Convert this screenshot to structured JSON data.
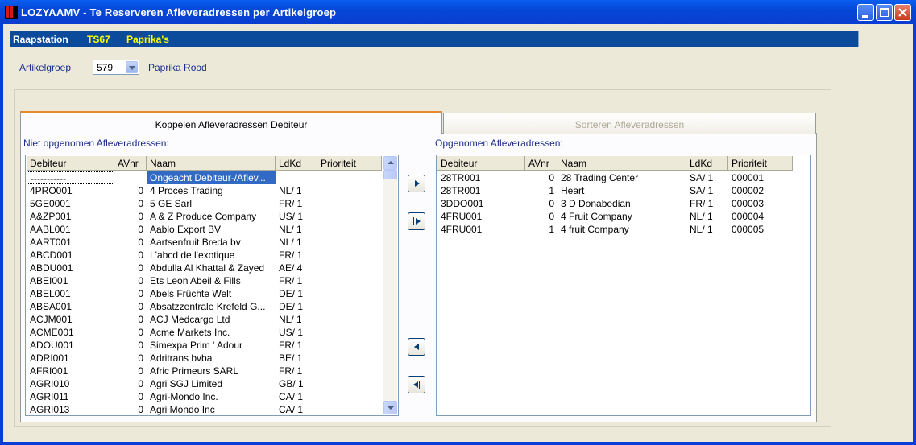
{
  "window": {
    "title": "LOZYAAMV - Te Reserveren Afleveradressen per Artikelgroep"
  },
  "info_bar": {
    "label": "Raapstation",
    "station": "TS67",
    "description": "Paprika's"
  },
  "artikelgroep": {
    "label": "Artikelgroep",
    "value": "579",
    "name": "Paprika Rood"
  },
  "tabs": [
    {
      "label": "Koppelen Afleveradressen Debiteur",
      "active": true
    },
    {
      "label": "Sorteren Afleveradressen",
      "active": false
    }
  ],
  "left_list": {
    "label": "Niet opgenomen Afleveradressen:",
    "columns": [
      "Debiteur",
      "AVnr",
      "Naam",
      "LdKd",
      "Prioriteit"
    ],
    "rows": [
      [
        "-----------",
        "",
        "Ongeacht Debiteur-/Aflev...",
        "",
        ""
      ],
      [
        "4PRO001",
        "0",
        "4 Proces Trading",
        "NL/ 1",
        ""
      ],
      [
        "5GE0001",
        "0",
        "5 GE Sarl",
        "FR/ 1",
        ""
      ],
      [
        "A&ZP001",
        "0",
        "A & Z Produce Company",
        "US/ 1",
        ""
      ],
      [
        "AABL001",
        "0",
        "Aablo Export BV",
        "NL/ 1",
        ""
      ],
      [
        "AART001",
        "0",
        "Aartsenfruit Breda bv",
        "NL/ 1",
        ""
      ],
      [
        "ABCD001",
        "0",
        "L'abcd de l'exotique",
        "FR/ 1",
        ""
      ],
      [
        "ABDU001",
        "0",
        "Abdulla Al Khattal & Zayed",
        "AE/ 4",
        ""
      ],
      [
        "ABEI001",
        "0",
        "Ets Leon Abeil & Fills",
        "FR/ 1",
        ""
      ],
      [
        "ABEL001",
        "0",
        "Abels Früchte Welt",
        "DE/ 1",
        ""
      ],
      [
        "ABSA001",
        "0",
        "Absatzzentrale Krefeld G...",
        "DE/ 1",
        ""
      ],
      [
        "ACJM001",
        "0",
        "ACJ Medcargo Ltd",
        "NL/ 1",
        ""
      ],
      [
        "ACME001",
        "0",
        "Acme Markets Inc.",
        "US/ 1",
        ""
      ],
      [
        "ADOU001",
        "0",
        "Simexpa Prim ' Adour",
        "FR/ 1",
        ""
      ],
      [
        "ADRI001",
        "0",
        "Adritrans bvba",
        "BE/ 1",
        ""
      ],
      [
        "AFRI001",
        "0",
        "Afric Primeurs SARL",
        "FR/ 1",
        ""
      ],
      [
        "AGRI010",
        "0",
        "Agri SGJ Limited",
        "GB/ 1",
        ""
      ],
      [
        "AGRI011",
        "0",
        "Agri-Mondo Inc.",
        "CA/ 1",
        ""
      ],
      [
        "AGRI013",
        "0",
        "Agri Mondo Inc",
        "CA/ 1",
        ""
      ]
    ]
  },
  "right_list": {
    "label": "Opgenomen Afleveradressen:",
    "columns": [
      "Debiteur",
      "AVnr",
      "Naam",
      "LdKd",
      "Prioriteit"
    ],
    "rows": [
      [
        "28TR001",
        "0",
        "28 Trading Center",
        "SA/ 1",
        "000001"
      ],
      [
        "28TR001",
        "1",
        "Heart",
        "SA/ 1",
        "000002"
      ],
      [
        "3DDO001",
        "0",
        "3 D Donabedian",
        "FR/ 1",
        "000003"
      ],
      [
        "4FRU001",
        "0",
        "4 Fruit Company",
        "NL/ 1",
        "000004"
      ],
      [
        "4FRU001",
        "1",
        "4 fruit Company",
        "NL/ 1",
        "000005"
      ]
    ]
  },
  "colors": {
    "title_bar": "#0548d8",
    "info_bar": "#0c4a9c",
    "info_highlight": "#ffff00",
    "selection": "#316ac5",
    "label_text": "#1a2c8a"
  }
}
